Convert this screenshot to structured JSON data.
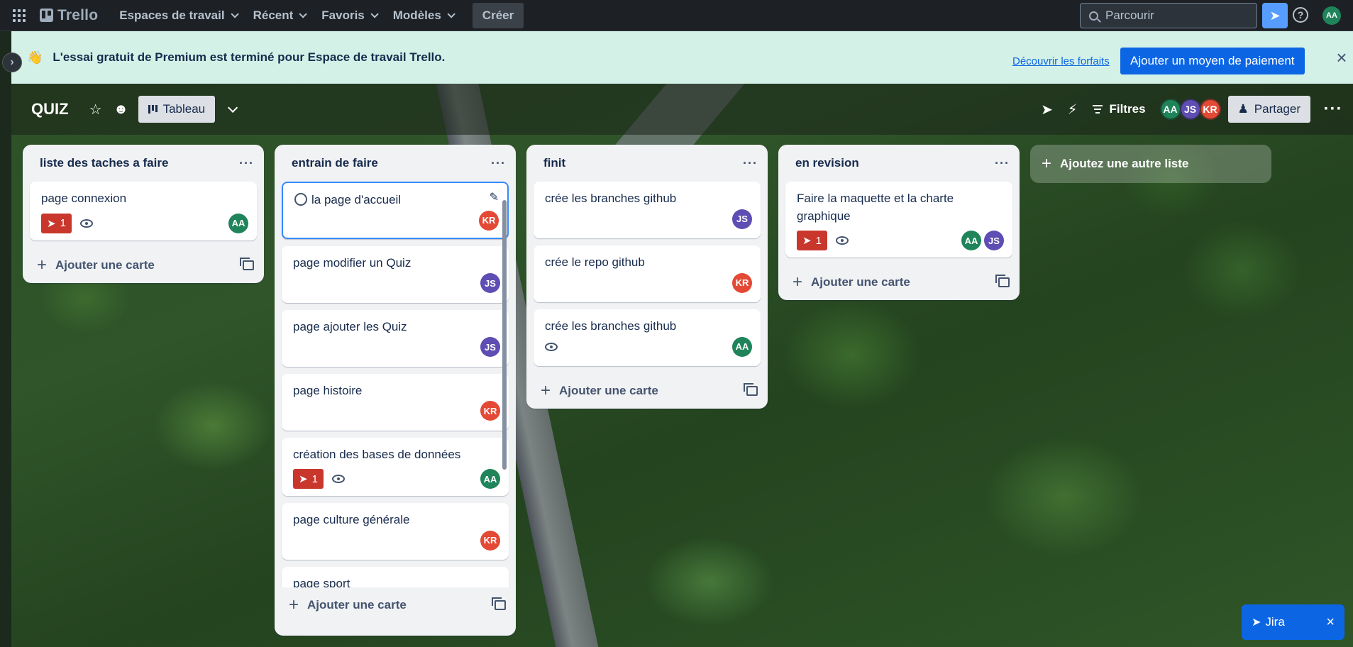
{
  "topbar": {
    "logo_text": "Trello",
    "nav": [
      {
        "label": "Espaces de travail"
      },
      {
        "label": "Récent"
      },
      {
        "label": "Favoris"
      },
      {
        "label": "Modèles"
      }
    ],
    "create_label": "Créer",
    "search_placeholder": "Parcourir",
    "user_initials": "AA"
  },
  "banner": {
    "emoji": "👋",
    "text": "L'essai gratuit de Premium est terminé pour Espace de travail Trello.",
    "link_label": "Découvrir les forfaits",
    "cta_label": "Ajouter un moyen de paiement"
  },
  "board": {
    "title": "QUIZ",
    "view_label": "Tableau",
    "filters_label": "Filtres",
    "share_label": "Partager",
    "members": [
      {
        "initials": "AA",
        "color": "#1f845a"
      },
      {
        "initials": "JS",
        "color": "#5e4db2"
      },
      {
        "initials": "KR",
        "color": "#e34935"
      }
    ],
    "add_list_label": "Ajoutez une autre liste",
    "add_card_label": "Ajouter une carte"
  },
  "lists": [
    {
      "title": "liste des taches a faire",
      "cards": [
        {
          "title": "page connexion",
          "badge": "1",
          "watch": true,
          "members": [
            "AA"
          ]
        }
      ]
    },
    {
      "title": "entrain de faire",
      "cards": [
        {
          "title": "la page d'accueil",
          "members": [
            "KR"
          ],
          "selected": true
        },
        {
          "title": "page modifier un Quiz",
          "members": [
            "JS"
          ]
        },
        {
          "title": "page ajouter les Quiz",
          "members": [
            "JS"
          ]
        },
        {
          "title": "page histoire",
          "members": [
            "KR"
          ]
        },
        {
          "title": "création des bases de données",
          "badge": "1",
          "watch": true,
          "members": [
            "AA"
          ]
        },
        {
          "title": "page culture générale",
          "members": [
            "KR"
          ]
        },
        {
          "title": "page sport",
          "members": []
        }
      ]
    },
    {
      "title": "finit",
      "cards": [
        {
          "title": "crée les branches github",
          "members": [
            "JS"
          ]
        },
        {
          "title": "crée le repo github",
          "members": [
            "KR"
          ]
        },
        {
          "title": "crée les branches github",
          "watch": true,
          "members": [
            "AA"
          ]
        }
      ]
    },
    {
      "title": "en revision",
      "cards": [
        {
          "title": "Faire la maquette et la charte graphique",
          "badge": "1",
          "watch": true,
          "members": [
            "AA",
            "JS"
          ]
        }
      ]
    }
  ],
  "jira": {
    "label": "Jira"
  },
  "colors": {
    "accent": "#0c66e4",
    "banner_bg": "#d3f1e7",
    "badge_red": "#c9372c"
  }
}
